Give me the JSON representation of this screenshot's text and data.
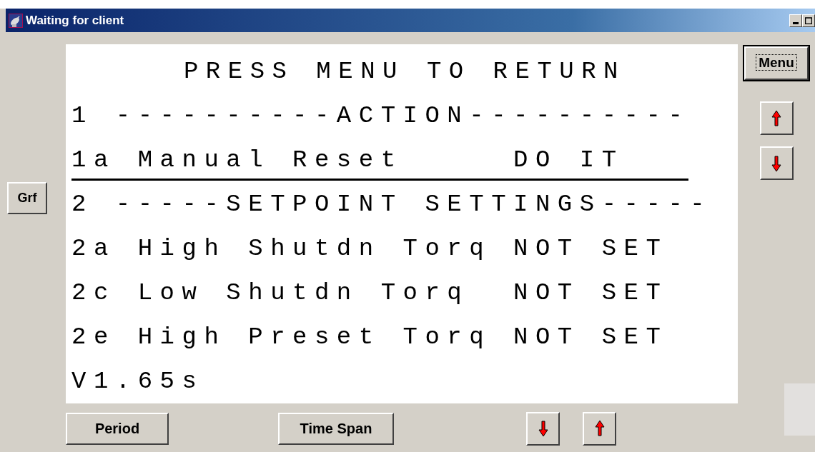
{
  "window": {
    "title": "Waiting for client"
  },
  "side_buttons": [
    {
      "label": "Menu",
      "focused": true
    }
  ],
  "screen": {
    "lines": [
      {
        "kind": "heading",
        "text": "PRESS MENU TO RETURN",
        "selected": false
      },
      {
        "kind": "item",
        "text": "1 ----------ACTION----------",
        "selected": false
      },
      {
        "kind": "item",
        "text": "1a Manual Reset     DO IT",
        "selected": true
      },
      {
        "kind": "item",
        "text": "2 -----SETPOINT SETTINGS-----",
        "selected": false
      },
      {
        "kind": "item",
        "text": "2a High Shutdn Torq NOT SET",
        "selected": false
      },
      {
        "kind": "item",
        "text": "2c Low Shutdn Torq  NOT SET",
        "selected": false
      },
      {
        "kind": "item",
        "text": "2e High Preset Torq NOT SET",
        "selected": false
      },
      {
        "kind": "item",
        "text": "V1.65s",
        "selected": false
      }
    ]
  },
  "left_button": {
    "label": "Grf"
  },
  "bottom_buttons": [
    {
      "kind": "text",
      "label": "Period"
    },
    {
      "kind": "text",
      "label": "Time Span"
    },
    {
      "kind": "down"
    },
    {
      "kind": "up"
    }
  ]
}
